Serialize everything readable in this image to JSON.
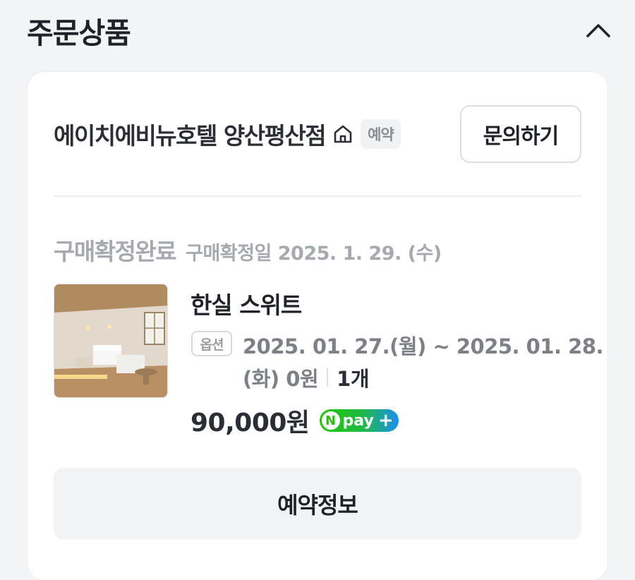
{
  "section": {
    "title": "주문상품"
  },
  "store": {
    "name": "에이치에비뉴호텔 양산평산점",
    "badge": "예약",
    "inquiry_label": "문의하기"
  },
  "order": {
    "status": "구매확정완료",
    "confirm_date": "구매확정일 2025. 1. 29. (수)"
  },
  "product": {
    "name": "한실 스위트",
    "option_badge": "옵션",
    "option_line1": "2025. 01. 27.(월) ~ 2025. 01. 28.",
    "option_line2": "(화) 0원",
    "quantity": "1개",
    "price": "90,000원",
    "pay_badge": "pay"
  },
  "reservation_label": "예약정보",
  "colors": {
    "npay_green": "#1ec800",
    "npay_blue": "#1a8ff0",
    "muted": "#a6a9af"
  }
}
